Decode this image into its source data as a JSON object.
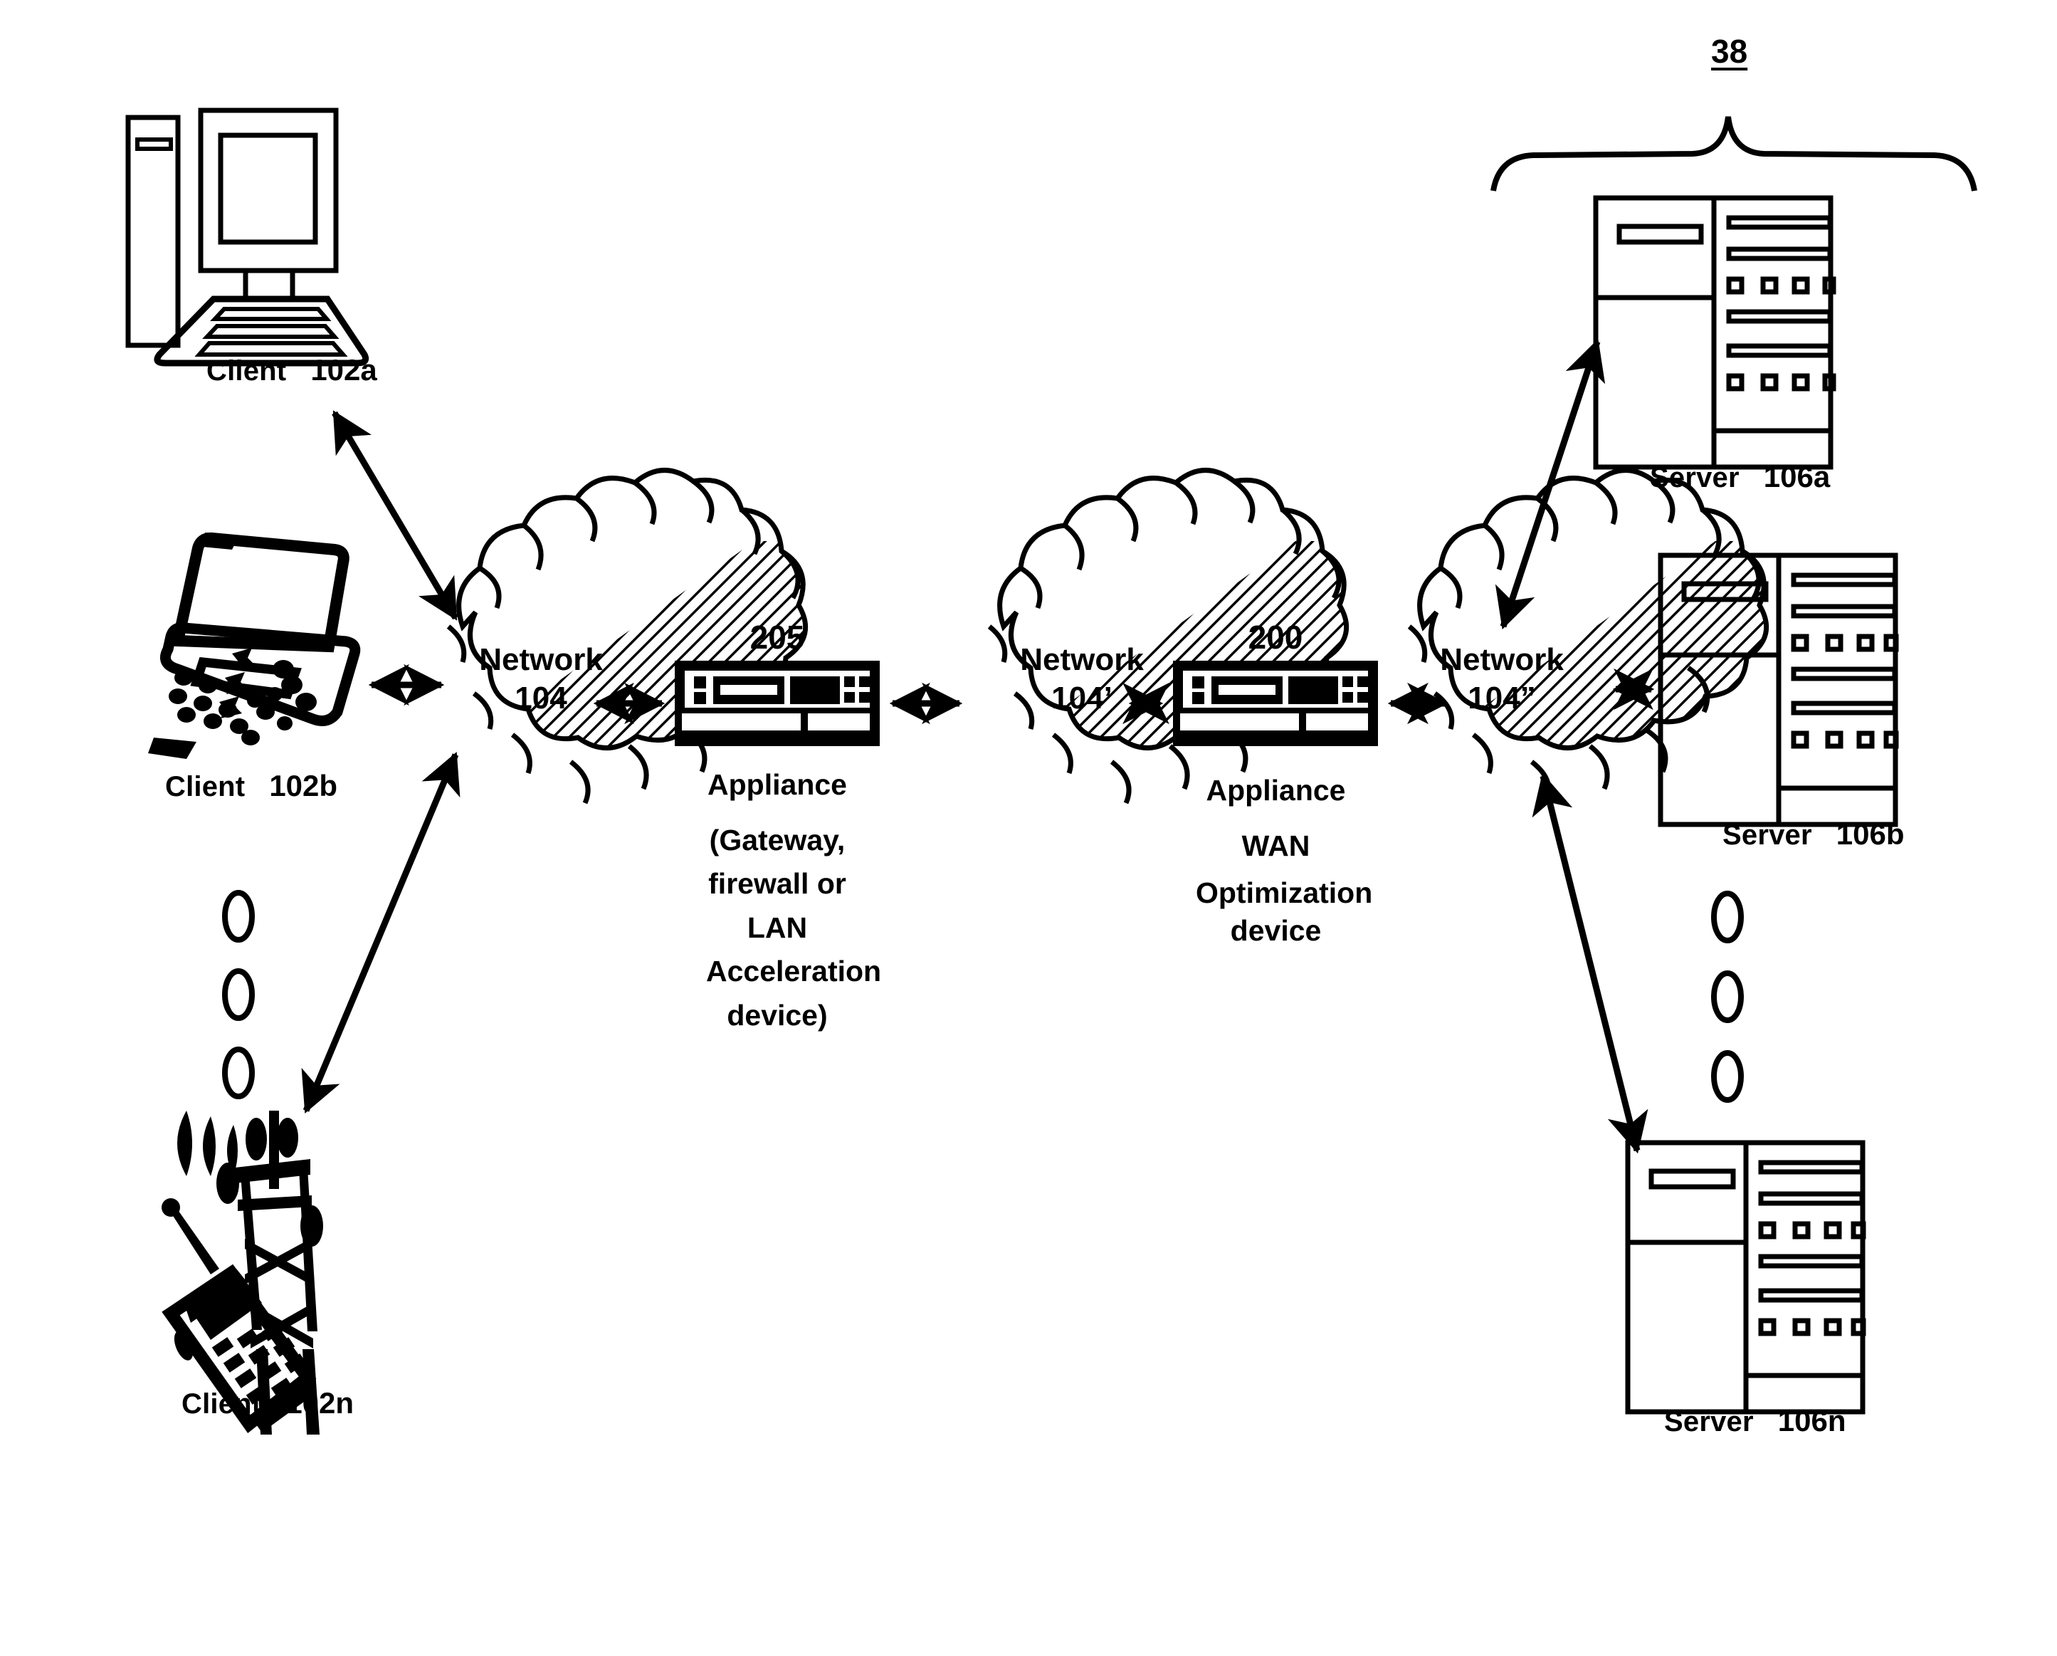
{
  "figure": {
    "type": "network-architecture-diagram",
    "background_color": "#ffffff",
    "stroke_color": "#000000"
  },
  "group_brace": {
    "reference": "38",
    "name": "server-farm-brace"
  },
  "clients": [
    {
      "icon": "desktop-computer-icon",
      "label": "Client",
      "reference": "102a"
    },
    {
      "icon": "laptop-computer-icon",
      "label": "Client",
      "reference": "102b"
    },
    {
      "icon": "mobile-phone-tower-icon",
      "label": "Client",
      "reference": "102n"
    }
  ],
  "client_ellipsis": "vertical-ellipsis",
  "networks": [
    {
      "icon": "cloud-icon",
      "name_line": "Network",
      "ref_line": "104"
    },
    {
      "icon": "cloud-icon",
      "name_line": "Network",
      "ref_line": "104’"
    },
    {
      "icon": "cloud-icon",
      "name_line": "Network",
      "ref_line": "104”"
    }
  ],
  "appliances": [
    {
      "reference": "205",
      "icon": "rack-appliance-icon",
      "caption_lines": [
        "Appliance",
        "(Gateway,",
        "firewall or",
        "LAN",
        "Acceleration",
        "device)"
      ]
    },
    {
      "reference": "200",
      "icon": "rack-appliance-icon",
      "caption_lines": [
        "Appliance",
        "WAN",
        "Optimization",
        "device"
      ]
    }
  ],
  "servers": [
    {
      "icon": "server-tower-icon",
      "label": "Server",
      "reference": "106a"
    },
    {
      "icon": "server-tower-icon",
      "label": "Server",
      "reference": "106b"
    },
    {
      "icon": "server-tower-icon",
      "label": "Server",
      "reference": "106n"
    }
  ],
  "server_ellipsis": "vertical-ellipsis",
  "connections": [
    {
      "from": "Client 102a",
      "to": "Network 104",
      "style": "double-arrow"
    },
    {
      "from": "Client 102b",
      "to": "Network 104",
      "style": "double-arrow"
    },
    {
      "from": "Client 102n",
      "to": "Network 104",
      "style": "double-arrow"
    },
    {
      "from": "Network 104",
      "to": "Appliance 205",
      "style": "double-arrow"
    },
    {
      "from": "Appliance 205",
      "to": "Network 104’",
      "style": "double-arrow"
    },
    {
      "from": "Network 104’",
      "to": "Appliance 200",
      "style": "double-arrow"
    },
    {
      "from": "Appliance 200",
      "to": "Network 104”",
      "style": "double-arrow"
    },
    {
      "from": "Network 104”",
      "to": "Server 106a",
      "style": "double-arrow"
    },
    {
      "from": "Network 104”",
      "to": "Server 106b",
      "style": "double-arrow"
    },
    {
      "from": "Network 104”",
      "to": "Server 106n",
      "style": "double-arrow"
    }
  ]
}
